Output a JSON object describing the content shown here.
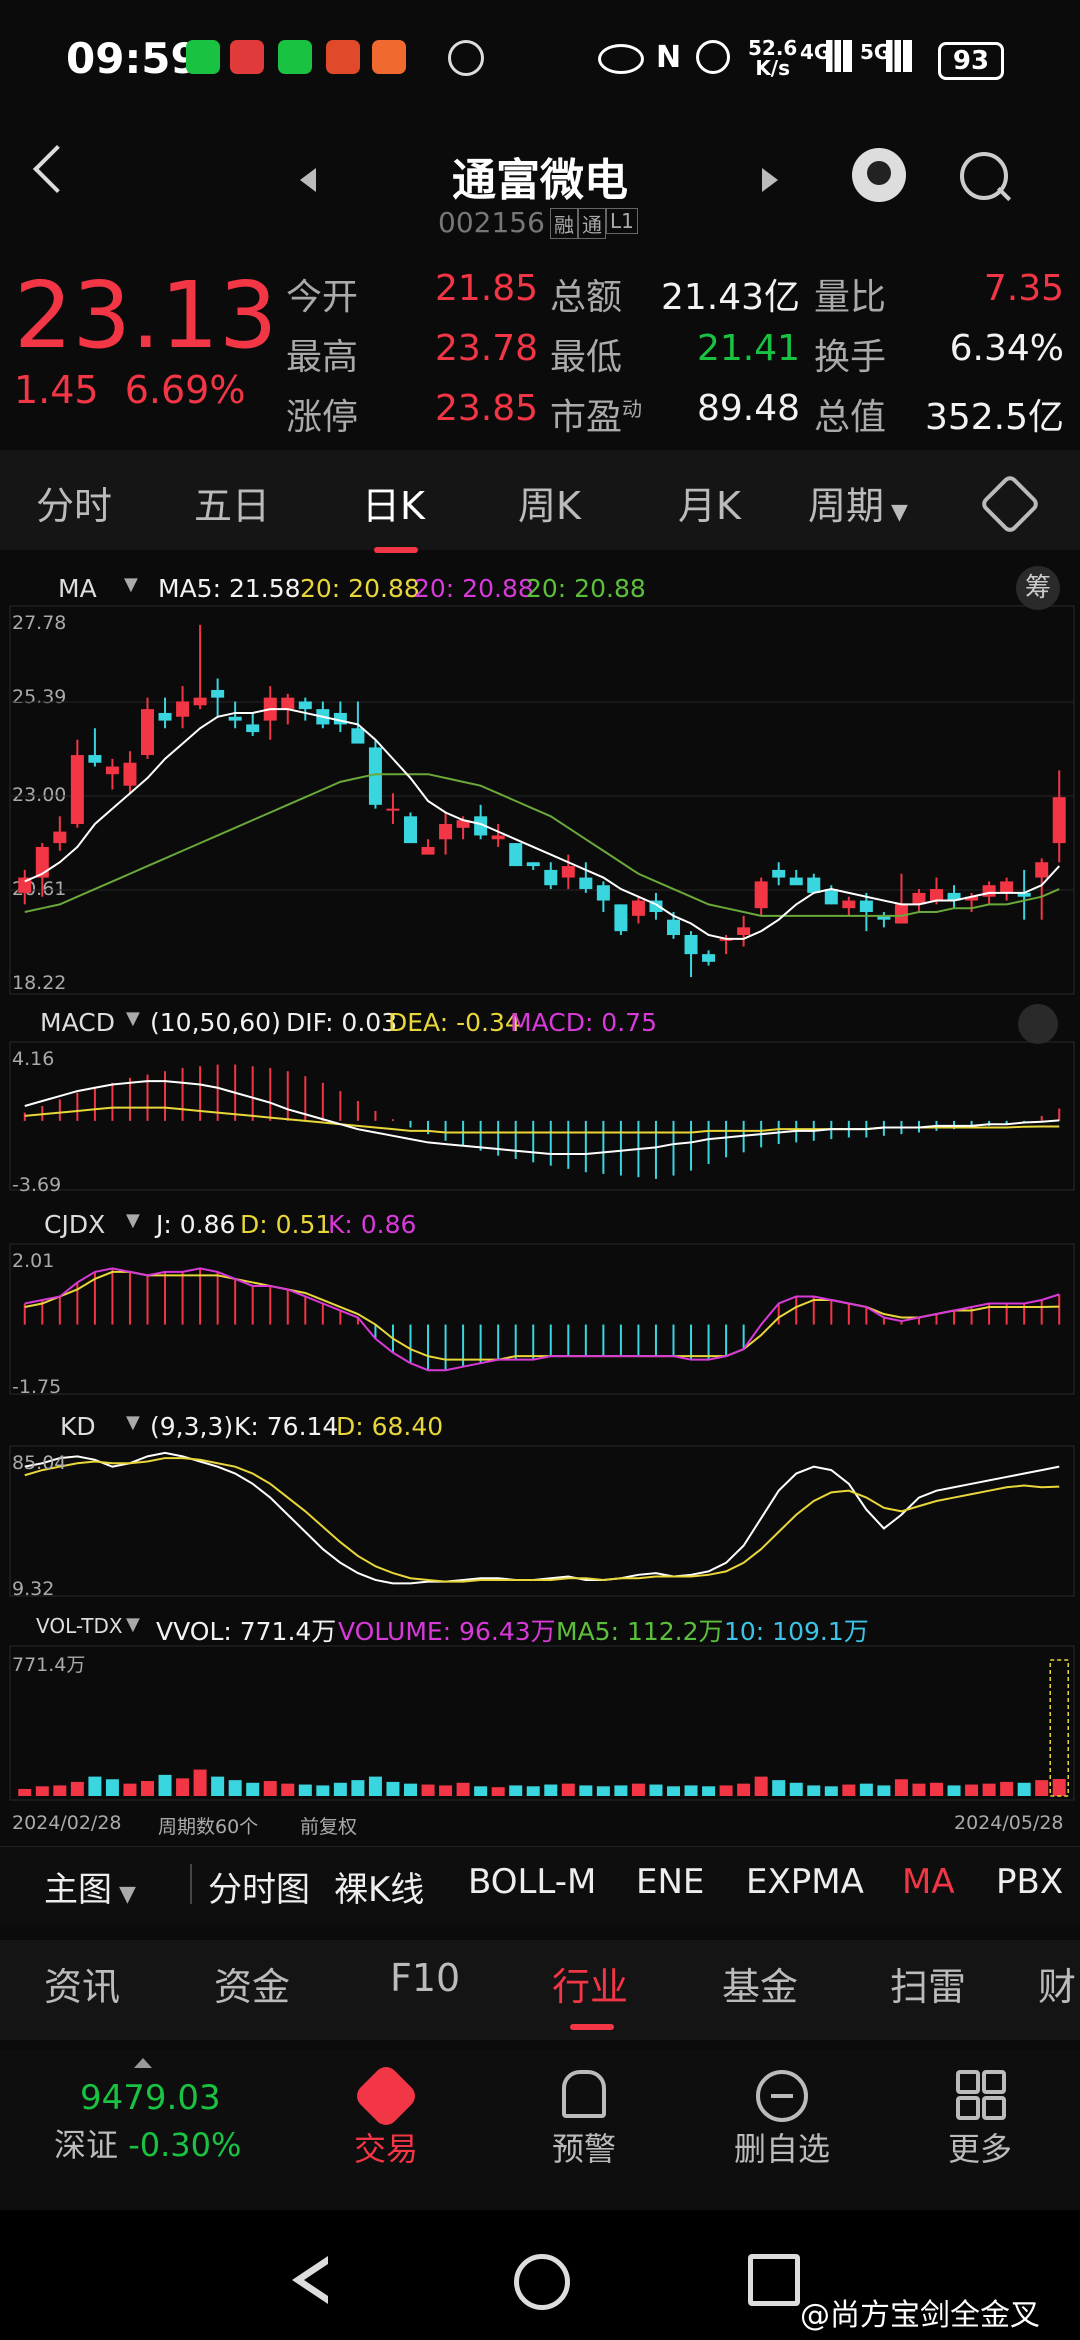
{
  "status_bar": {
    "time": "09:59",
    "net_speed": "52.6",
    "net_unit": "K/s",
    "signal1": "4G",
    "signal2": "5G",
    "battery": "93"
  },
  "header": {
    "title": "通富微电",
    "code": "002156",
    "tag1": "融",
    "tag2": "通",
    "tag3": "L1"
  },
  "quote": {
    "price": "23.13",
    "change": "1.45",
    "change_pct": "6.69%",
    "rows": [
      {
        "l1": "今开",
        "v1": "21.85",
        "l2": "总额",
        "v2": "21.43亿",
        "l3": "量比",
        "v3": "7.35"
      },
      {
        "l1": "最高",
        "v1": "23.78",
        "l2": "最低",
        "v2": "21.41",
        "l3": "换手",
        "v3": "6.34%"
      },
      {
        "l1": "涨停",
        "v1": "23.85",
        "l2": "市盈",
        "v2": "89.48",
        "l3": "总值",
        "v3": "352.5亿"
      }
    ],
    "pe_sup": "动"
  },
  "tabs": [
    "分时",
    "五日",
    "日K",
    "周K",
    "月K",
    "周期"
  ],
  "ma_panel": {
    "label": "MA",
    "ma5": "MA5: 21.58",
    "ma20a": "20: 20.88",
    "ma20b": "20: 20.88",
    "ma20c": "20: 20.88",
    "chip": "筹",
    "y": [
      "27.78",
      "25.39",
      "23.00",
      "20.61",
      "18.22"
    ]
  },
  "macd_panel": {
    "label": "MACD",
    "params": "(10,50,60)",
    "dif": "DIF: 0.03",
    "dea": "DEA: -0.34",
    "macd": "MACD: 0.75",
    "y": [
      "4.16",
      "-3.69"
    ]
  },
  "cjdx_panel": {
    "label": "CJDX",
    "j": "J: 0.86",
    "d": "D: 0.51",
    "k": "K: 0.86",
    "y": [
      "2.01",
      "-1.75"
    ]
  },
  "kd_panel": {
    "label": "KD",
    "params": "(9,3,3)",
    "k": "K: 76.14",
    "d": "D: 68.40",
    "y": [
      "85.04",
      "9.32"
    ]
  },
  "vol_panel": {
    "label": "VOL-TDX",
    "vvol": "VVOL: 771.4万",
    "volume": "VOLUME: 96.43万",
    "ma5": "MA5: 112.2万",
    "ma10": "10: 109.1万",
    "y": "771.4万"
  },
  "footer_axis": {
    "start": "2024/02/28",
    "period": "周期数60个",
    "adjust": "前复权",
    "end": "2024/05/28"
  },
  "indicators": [
    "主图",
    "分时图",
    "裸K线",
    "BOLL-M",
    "ENE",
    "EXPMA",
    "MA",
    "PBX"
  ],
  "info_tabs": [
    "资讯",
    "资金",
    "F10",
    "行业",
    "基金",
    "扫雷",
    "财"
  ],
  "bottom_nav": {
    "index_value": "9479.03",
    "index_name": "深证",
    "index_change": "-0.30%",
    "trade": "交易",
    "alert": "预警",
    "remove": "删自选",
    "more": "更多"
  },
  "watermark": "@尚方宝剑全金叉",
  "colors": {
    "up": "#f23645",
    "down": "#3ad6e0",
    "ma5": "#ffffff",
    "ma20": "#6aa83a",
    "dea": "#e8d63a",
    "accent": "#f23645"
  },
  "chart_data": [
    {
      "type": "candlestick",
      "title": "MA",
      "ylim": [
        18.22,
        27.78
      ],
      "x_start": "2024/02/28",
      "x_end": "2024/05/28",
      "ohlc": [
        [
          20.6,
          21.2,
          20.3,
          21.0
        ],
        [
          21.0,
          21.9,
          20.5,
          21.8
        ],
        [
          21.9,
          22.6,
          21.7,
          22.2
        ],
        [
          22.4,
          24.6,
          22.3,
          24.2
        ],
        [
          24.2,
          24.9,
          23.9,
          24.0
        ],
        [
          23.7,
          24.1,
          23.3,
          23.9
        ],
        [
          23.4,
          24.3,
          23.2,
          24.0
        ],
        [
          24.2,
          25.7,
          24.1,
          25.4
        ],
        [
          25.3,
          25.7,
          24.9,
          25.1
        ],
        [
          25.2,
          26.0,
          24.9,
          25.6
        ],
        [
          25.5,
          27.6,
          25.4,
          25.7
        ],
        [
          25.9,
          26.2,
          25.2,
          25.7
        ],
        [
          25.2,
          25.6,
          24.9,
          25.1
        ],
        [
          25.0,
          25.3,
          24.7,
          24.8
        ],
        [
          25.1,
          26.0,
          24.6,
          25.7
        ],
        [
          25.4,
          25.8,
          25.0,
          25.7
        ],
        [
          25.6,
          25.7,
          25.1,
          25.4
        ],
        [
          25.4,
          25.6,
          24.9,
          25.0
        ],
        [
          25.3,
          25.6,
          24.8,
          25.0
        ],
        [
          24.9,
          25.6,
          24.7,
          24.5
        ],
        [
          24.4,
          24.6,
          22.8,
          22.9
        ],
        [
          22.8,
          23.2,
          22.4,
          22.8
        ],
        [
          22.6,
          22.7,
          21.9,
          21.9
        ],
        [
          21.6,
          22.0,
          21.6,
          21.8
        ],
        [
          22.0,
          22.7,
          21.6,
          22.4
        ],
        [
          22.3,
          22.6,
          22.0,
          22.5
        ],
        [
          22.6,
          22.9,
          22.0,
          22.1
        ],
        [
          22.0,
          22.4,
          21.8,
          22.1
        ],
        [
          21.9,
          21.9,
          21.3,
          21.3
        ],
        [
          21.4,
          21.4,
          21.2,
          21.3
        ],
        [
          21.2,
          21.4,
          20.7,
          20.8
        ],
        [
          21.0,
          21.6,
          20.7,
          21.3
        ],
        [
          21.0,
          21.4,
          20.6,
          20.7
        ],
        [
          20.8,
          20.9,
          20.1,
          20.4
        ],
        [
          20.3,
          20.3,
          19.5,
          19.6
        ],
        [
          20.0,
          20.5,
          19.8,
          20.4
        ],
        [
          20.4,
          20.6,
          19.9,
          20.1
        ],
        [
          19.9,
          20.1,
          19.4,
          19.5
        ],
        [
          19.5,
          19.6,
          18.4,
          19.0
        ],
        [
          19.0,
          19.1,
          18.7,
          18.8
        ],
        [
          19.4,
          19.5,
          19.0,
          19.4
        ],
        [
          19.5,
          20.0,
          19.2,
          19.7
        ],
        [
          20.2,
          21.0,
          20.0,
          20.9
        ],
        [
          21.2,
          21.4,
          20.8,
          21.0
        ],
        [
          21.0,
          21.2,
          20.9,
          20.8
        ],
        [
          21.0,
          21.1,
          20.7,
          20.6
        ],
        [
          20.7,
          20.8,
          20.3,
          20.3
        ],
        [
          20.2,
          20.5,
          20.0,
          20.4
        ],
        [
          20.4,
          20.6,
          19.6,
          20.1
        ],
        [
          20.0,
          20.1,
          19.7,
          19.9
        ],
        [
          19.8,
          21.1,
          19.8,
          20.3
        ],
        [
          20.3,
          20.7,
          20.1,
          20.6
        ],
        [
          20.4,
          21.0,
          20.3,
          20.7
        ],
        [
          20.6,
          20.8,
          20.2,
          20.4
        ],
        [
          20.4,
          20.6,
          20.1,
          20.5
        ],
        [
          20.5,
          20.9,
          20.3,
          20.8
        ],
        [
          20.6,
          21.0,
          20.4,
          20.9
        ],
        [
          20.6,
          21.2,
          19.9,
          20.5
        ],
        [
          21.0,
          21.5,
          19.9,
          21.4
        ],
        [
          21.9,
          23.8,
          21.4,
          23.1
        ]
      ],
      "ma5": [
        20.9,
        21.1,
        21.4,
        21.8,
        22.4,
        22.8,
        23.2,
        23.6,
        24.1,
        24.5,
        24.9,
        25.2,
        25.3,
        25.3,
        25.4,
        25.4,
        25.3,
        25.2,
        25.1,
        25.0,
        24.6,
        24.1,
        23.6,
        23.0,
        22.7,
        22.5,
        22.4,
        22.2,
        22.0,
        21.8,
        21.6,
        21.4,
        21.2,
        21.0,
        20.7,
        20.5,
        20.3,
        20.0,
        19.8,
        19.5,
        19.4,
        19.4,
        19.6,
        19.9,
        20.3,
        20.6,
        20.7,
        20.6,
        20.5,
        20.4,
        20.3,
        20.3,
        20.4,
        20.4,
        20.5,
        20.6,
        20.6,
        20.6,
        20.8,
        21.3
      ],
      "ma20": [
        20.1,
        20.2,
        20.3,
        20.5,
        20.7,
        20.9,
        21.1,
        21.3,
        21.5,
        21.7,
        21.9,
        22.1,
        22.3,
        22.5,
        22.7,
        22.9,
        23.1,
        23.3,
        23.5,
        23.6,
        23.7,
        23.7,
        23.7,
        23.7,
        23.6,
        23.5,
        23.4,
        23.2,
        23.0,
        22.8,
        22.6,
        22.3,
        22.0,
        21.7,
        21.4,
        21.1,
        20.9,
        20.7,
        20.5,
        20.3,
        20.2,
        20.1,
        20.0,
        20.0,
        20.0,
        20.0,
        20.0,
        20.0,
        20.0,
        20.0,
        20.0,
        20.1,
        20.1,
        20.2,
        20.2,
        20.3,
        20.3,
        20.4,
        20.5,
        20.7
      ]
    },
    {
      "type": "bar",
      "title": "MACD",
      "ylim": [
        -3.69,
        4.16
      ],
      "values": [
        0.5,
        0.9,
        1.3,
        1.7,
        2.0,
        2.3,
        2.6,
        2.8,
        3.0,
        3.2,
        3.3,
        3.4,
        3.4,
        3.3,
        3.2,
        3.0,
        2.7,
        2.3,
        1.8,
        1.2,
        0.6,
        0.1,
        -0.4,
        -0.8,
        -1.2,
        -1.5,
        -1.8,
        -2.1,
        -2.3,
        -2.5,
        -2.7,
        -2.9,
        -3.1,
        -3.2,
        -3.3,
        -3.4,
        -3.5,
        -3.3,
        -3.0,
        -2.6,
        -2.2,
        -1.9,
        -1.6,
        -1.4,
        -1.3,
        -1.2,
        -1.1,
        -1.0,
        -1.0,
        -0.9,
        -0.8,
        -0.7,
        -0.6,
        -0.5,
        -0.4,
        -0.3,
        -0.2,
        -0.1,
        0.3,
        0.75
      ],
      "dif": [
        0.9,
        1.2,
        1.5,
        1.8,
        2.0,
        2.2,
        2.3,
        2.4,
        2.4,
        2.3,
        2.2,
        2.0,
        1.7,
        1.4,
        1.1,
        0.7,
        0.4,
        0.1,
        -0.2,
        -0.5,
        -0.7,
        -0.9,
        -1.1,
        -1.3,
        -1.4,
        -1.5,
        -1.6,
        -1.7,
        -1.8,
        -1.9,
        -2.0,
        -2.0,
        -2.0,
        -1.9,
        -1.8,
        -1.7,
        -1.6,
        -1.4,
        -1.3,
        -1.1,
        -1.0,
        -0.9,
        -0.8,
        -0.7,
        -0.6,
        -0.6,
        -0.5,
        -0.5,
        -0.5,
        -0.4,
        -0.4,
        -0.4,
        -0.3,
        -0.3,
        -0.3,
        -0.2,
        -0.2,
        -0.1,
        -0.05,
        0.03
      ],
      "dea": [
        0.3,
        0.4,
        0.5,
        0.6,
        0.7,
        0.8,
        0.8,
        0.8,
        0.8,
        0.7,
        0.6,
        0.5,
        0.4,
        0.3,
        0.2,
        0.1,
        0.0,
        -0.1,
        -0.2,
        -0.3,
        -0.4,
        -0.5,
        -0.6,
        -0.6,
        -0.7,
        -0.7,
        -0.7,
        -0.7,
        -0.7,
        -0.7,
        -0.7,
        -0.7,
        -0.7,
        -0.7,
        -0.7,
        -0.7,
        -0.7,
        -0.7,
        -0.7,
        -0.6,
        -0.6,
        -0.6,
        -0.6,
        -0.5,
        -0.5,
        -0.5,
        -0.5,
        -0.5,
        -0.5,
        -0.4,
        -0.4,
        -0.4,
        -0.4,
        -0.4,
        -0.4,
        -0.4,
        -0.4,
        -0.35,
        -0.34,
        -0.34
      ]
    },
    {
      "type": "bar",
      "title": "CJDX",
      "ylim": [
        -1.75,
        2.01
      ],
      "values": [
        0.6,
        0.7,
        0.8,
        1.2,
        1.5,
        1.6,
        1.5,
        1.4,
        1.5,
        1.5,
        1.6,
        1.5,
        1.3,
        1.1,
        1.1,
        1.0,
        0.8,
        0.6,
        0.4,
        0.2,
        -0.4,
        -0.8,
        -1.1,
        -1.3,
        -1.3,
        -1.2,
        -1.1,
        -1.0,
        -1.0,
        -1.0,
        -0.9,
        -0.9,
        -0.9,
        -0.9,
        -0.9,
        -0.9,
        -0.9,
        -0.9,
        -1.0,
        -1.0,
        -0.9,
        -0.7,
        0.0,
        0.6,
        0.8,
        0.8,
        0.7,
        0.6,
        0.5,
        0.2,
        0.1,
        0.2,
        0.3,
        0.4,
        0.5,
        0.6,
        0.6,
        0.6,
        0.7,
        0.86
      ],
      "d": [
        0.5,
        0.6,
        0.8,
        1.0,
        1.3,
        1.5,
        1.5,
        1.4,
        1.4,
        1.4,
        1.4,
        1.4,
        1.3,
        1.2,
        1.1,
        1.0,
        0.9,
        0.7,
        0.5,
        0.3,
        0.0,
        -0.4,
        -0.7,
        -0.9,
        -1.0,
        -1.0,
        -1.0,
        -1.0,
        -0.9,
        -0.9,
        -0.9,
        -0.9,
        -0.9,
        -0.9,
        -0.9,
        -0.9,
        -0.9,
        -0.9,
        -0.9,
        -0.9,
        -0.9,
        -0.7,
        -0.3,
        0.2,
        0.5,
        0.7,
        0.7,
        0.6,
        0.5,
        0.3,
        0.2,
        0.2,
        0.3,
        0.4,
        0.4,
        0.5,
        0.5,
        0.5,
        0.5,
        0.51
      ]
    },
    {
      "type": "line",
      "title": "KD",
      "ylim": [
        9.32,
        85.04
      ],
      "series": [
        {
          "name": "K",
          "values": [
            80,
            82,
            85,
            86,
            84,
            80,
            82,
            86,
            88,
            86,
            83,
            80,
            76,
            70,
            62,
            52,
            42,
            32,
            24,
            18,
            14,
            12,
            12,
            13,
            13,
            14,
            15,
            15,
            14,
            14,
            15,
            16,
            14,
            14,
            15,
            17,
            18,
            16,
            17,
            19,
            24,
            34,
            50,
            66,
            76,
            80,
            78,
            70,
            55,
            44,
            52,
            62,
            66,
            68,
            70,
            72,
            74,
            76,
            78,
            80
          ]
        },
        {
          "name": "D",
          "values": [
            75,
            78,
            80,
            82,
            83,
            82,
            82,
            83,
            85,
            85,
            84,
            82,
            80,
            76,
            70,
            62,
            54,
            45,
            36,
            28,
            22,
            18,
            15,
            14,
            13,
            13,
            14,
            14,
            14,
            14,
            14,
            15,
            15,
            14,
            15,
            15,
            16,
            16,
            16,
            17,
            19,
            24,
            32,
            42,
            52,
            60,
            65,
            66,
            62,
            56,
            54,
            57,
            60,
            62,
            64,
            66,
            68,
            69,
            68,
            68.4
          ]
        }
      ]
    },
    {
      "type": "bar",
      "title": "VOL-TDX",
      "ylim": [
        0,
        771.4
      ],
      "values": [
        40,
        55,
        60,
        80,
        110,
        95,
        70,
        85,
        120,
        100,
        150,
        110,
        90,
        75,
        85,
        70,
        65,
        60,
        75,
        90,
        110,
        80,
        70,
        65,
        60,
        75,
        55,
        50,
        60,
        55,
        65,
        70,
        60,
        55,
        60,
        70,
        65,
        55,
        60,
        55,
        60,
        70,
        110,
        90,
        75,
        60,
        55,
        65,
        70,
        60,
        95,
        70,
        75,
        60,
        65,
        70,
        80,
        75,
        90,
        96.43
      ],
      "up": [
        true,
        true,
        true,
        true,
        false,
        false,
        true,
        true,
        false,
        true,
        true,
        false,
        false,
        false,
        true,
        true,
        false,
        false,
        false,
        false,
        false,
        false,
        false,
        true,
        true,
        true,
        false,
        true,
        false,
        false,
        false,
        true,
        false,
        false,
        false,
        true,
        false,
        false,
        false,
        false,
        true,
        true,
        true,
        false,
        false,
        false,
        false,
        true,
        false,
        false,
        true,
        true,
        true,
        false,
        true,
        true,
        true,
        false,
        true,
        true
      ]
    }
  ]
}
